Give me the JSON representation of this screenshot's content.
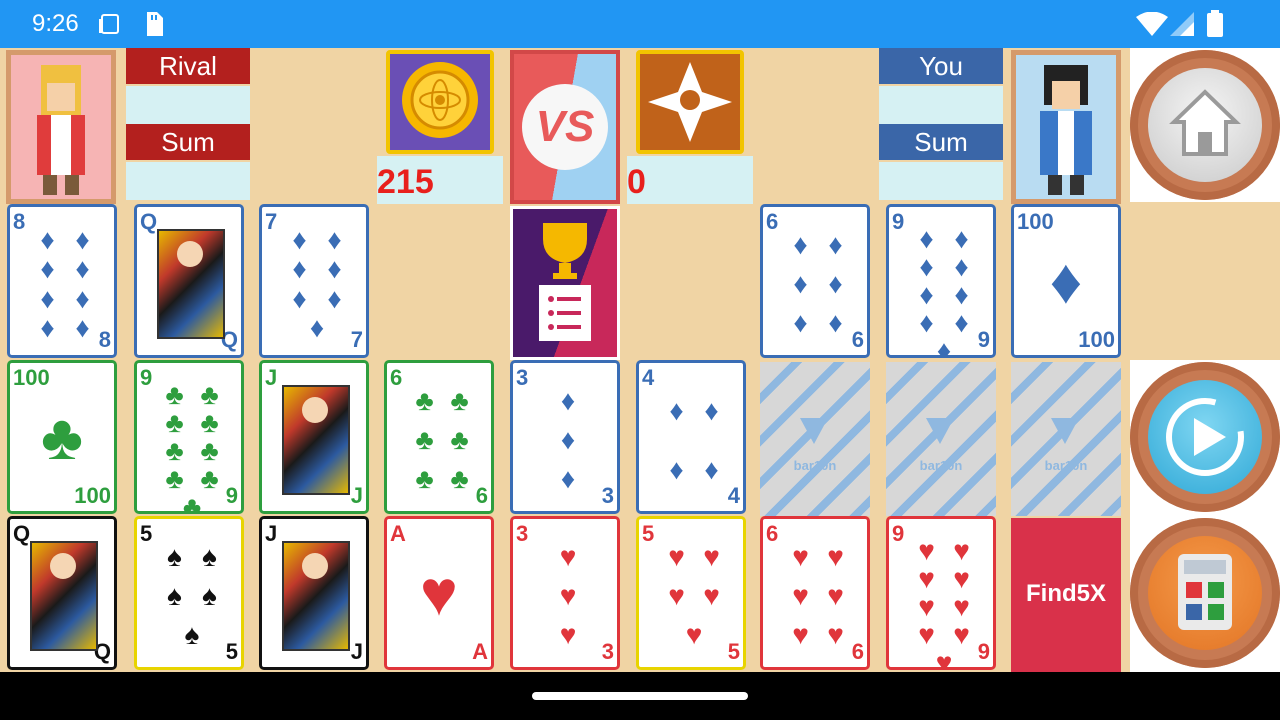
{
  "status": {
    "time": "9:26"
  },
  "header": {
    "rival_label": "Rival",
    "rival_sum_label": "Sum",
    "you_label": "You",
    "you_sum_label": "Sum",
    "coins_score": "215",
    "points_score": "0"
  },
  "center": {
    "vs_text": "VS",
    "find_label": "Find5X",
    "back_logo": "bar10n"
  },
  "row1": [
    {
      "rank": "8",
      "suit": "♦",
      "color": "blue",
      "pips": 8
    },
    {
      "rank": "Q",
      "suit": "♦",
      "color": "blue",
      "face": true
    },
    {
      "rank": "7",
      "suit": "♦",
      "color": "blue",
      "pips": 7
    },
    {
      "rank": "6",
      "suit": "♦",
      "color": "blue",
      "pips": 6
    },
    {
      "rank": "9",
      "suit": "♦",
      "color": "blue",
      "pips": 9
    },
    {
      "rank": "100",
      "suit": "♦",
      "color": "blue",
      "big": true
    }
  ],
  "row2": [
    {
      "rank": "100",
      "suit": "♣",
      "color": "green",
      "big": true
    },
    {
      "rank": "9",
      "suit": "♣",
      "color": "green",
      "pips": 9
    },
    {
      "rank": "J",
      "suit": "♣",
      "color": "green",
      "face": true
    },
    {
      "rank": "6",
      "suit": "♣",
      "color": "green",
      "pips": 6
    },
    {
      "rank": "3",
      "suit": "♦",
      "color": "blue",
      "pips": 3
    },
    {
      "rank": "4",
      "suit": "♦",
      "color": "blue",
      "pips": 4
    }
  ],
  "row3": [
    {
      "rank": "Q",
      "suit": "♠",
      "color": "black",
      "face": true
    },
    {
      "rank": "5",
      "suit": "♠",
      "color": "yellow",
      "pips": 5
    },
    {
      "rank": "J",
      "suit": "♠",
      "color": "black",
      "face": true
    },
    {
      "rank": "A",
      "suit": "♥",
      "color": "red",
      "big": true
    },
    {
      "rank": "3",
      "suit": "♥",
      "color": "red",
      "pips": 3
    },
    {
      "rank": "5",
      "suit": "♥",
      "color": "yellowred",
      "pips": 5
    },
    {
      "rank": "6",
      "suit": "♥",
      "color": "red",
      "pips": 6
    },
    {
      "rank": "9",
      "suit": "♥",
      "color": "red",
      "pips": 9
    }
  ]
}
